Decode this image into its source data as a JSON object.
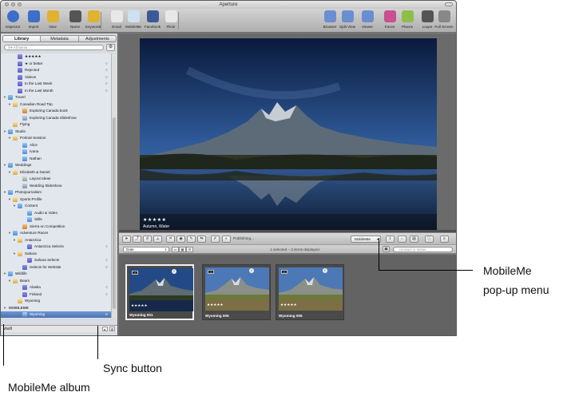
{
  "window": {
    "title": "Aperture"
  },
  "toolbar": {
    "left": [
      {
        "label": "Inspector",
        "icon": "inspector-info-icon"
      },
      {
        "label": "Import",
        "icon": "import-arrow-icon"
      },
      {
        "label": "New",
        "icon": "new-album-icon"
      },
      {
        "label": "Name",
        "icon": "name-badge-icon"
      },
      {
        "label": "Keywords",
        "icon": "keywords-tag-icon"
      },
      {
        "label": "Email",
        "icon": "email-icon"
      },
      {
        "label": "MobileMe",
        "icon": "mobileme-cloud-icon"
      },
      {
        "label": "Facebook",
        "icon": "facebook-icon"
      },
      {
        "label": "Flickr",
        "icon": "flickr-icon"
      }
    ],
    "right": [
      {
        "label": "Browser",
        "icon": "browser-grid-icon"
      },
      {
        "label": "Split View",
        "icon": "split-view-icon"
      },
      {
        "label": "Viewer",
        "icon": "viewer-icon"
      },
      {
        "label": "Faces",
        "icon": "faces-icon"
      },
      {
        "label": "Places",
        "icon": "places-icon"
      },
      {
        "label": "Loupe",
        "icon": "loupe-icon"
      },
      {
        "label": "Full Screen",
        "icon": "full-screen-icon"
      }
    ]
  },
  "sidebar": {
    "tabs": [
      {
        "label": "Library",
        "active": true
      },
      {
        "label": "Metadata",
        "active": false
      },
      {
        "label": "Adjustments",
        "active": false
      }
    ],
    "search_placeholder": "All Items",
    "items": [
      {
        "label": "★★★★★",
        "icon": "smart-album",
        "indent": 2
      },
      {
        "label": "★ or better",
        "icon": "smart-album",
        "indent": 2,
        "right": "⚲"
      },
      {
        "label": "Rejected",
        "icon": "smart-album",
        "indent": 2,
        "right": "⚲"
      },
      {
        "label": "Videos",
        "icon": "smart-album",
        "indent": 2,
        "right": "⚲"
      },
      {
        "label": "In the Last Week",
        "icon": "smart-album",
        "indent": 2,
        "right": "⚲"
      },
      {
        "label": "In the Last Month",
        "icon": "smart-album",
        "indent": 2,
        "right": "⚲"
      },
      {
        "label": "Travel",
        "icon": "folder",
        "indent": 0,
        "disclosure": "▼"
      },
      {
        "label": "Canadian Road Trip",
        "icon": "project",
        "indent": 1,
        "disclosure": "▼"
      },
      {
        "label": "Exploring Canada book",
        "icon": "book",
        "indent": 3
      },
      {
        "label": "Exploring Canada Slideshow",
        "icon": "slideshow",
        "indent": 3
      },
      {
        "label": "Flying",
        "icon": "project",
        "indent": 1
      },
      {
        "label": "Studio",
        "icon": "folder",
        "indent": 0,
        "disclosure": "▼"
      },
      {
        "label": "Portrait Session",
        "icon": "project",
        "indent": 1,
        "disclosure": "▼"
      },
      {
        "label": "Alice",
        "icon": "album",
        "indent": 3
      },
      {
        "label": "Ivana",
        "icon": "album",
        "indent": 3
      },
      {
        "label": "Nathan",
        "icon": "album",
        "indent": 3
      },
      {
        "label": "Weddings",
        "icon": "folder",
        "indent": 0,
        "disclosure": "▼"
      },
      {
        "label": "Elizabeth & Daniel",
        "icon": "project",
        "indent": 1,
        "disclosure": "▼"
      },
      {
        "label": "Layout Ideas",
        "icon": "light-table",
        "indent": 3
      },
      {
        "label": "Wedding Slideshow",
        "icon": "slideshow",
        "indent": 3
      },
      {
        "label": "Photojournalism",
        "icon": "folder",
        "indent": 0,
        "disclosure": "▼"
      },
      {
        "label": "Sports Profile",
        "icon": "project",
        "indent": 1,
        "disclosure": "▼"
      },
      {
        "label": "Content",
        "icon": "folder",
        "indent": 2,
        "disclosure": "▼"
      },
      {
        "label": "Audio & Video",
        "icon": "album",
        "indent": 4
      },
      {
        "label": "Stills",
        "icon": "album",
        "indent": 4
      },
      {
        "label": "Sierra on Competition",
        "icon": "book",
        "indent": 3
      },
      {
        "label": "Adventure Races",
        "icon": "folder",
        "indent": 1,
        "disclosure": "▼"
      },
      {
        "label": "Antarctica",
        "icon": "project",
        "indent": 2,
        "disclosure": "▼"
      },
      {
        "label": "Antarctica Selects",
        "icon": "smart-album",
        "indent": 4,
        "right": "⚲"
      },
      {
        "label": "Sahara",
        "icon": "project",
        "indent": 2,
        "disclosure": "▼"
      },
      {
        "label": "Sahara Selects",
        "icon": "smart-album",
        "indent": 4,
        "right": "⚲"
      },
      {
        "label": "Selects for Website",
        "icon": "smart-album",
        "indent": 3,
        "right": "⚲"
      },
      {
        "label": "Wildlife",
        "icon": "folder",
        "indent": 0,
        "disclosure": "▼"
      },
      {
        "label": "Bears",
        "icon": "project",
        "indent": 1,
        "disclosure": "▼"
      },
      {
        "label": "Alaska",
        "icon": "smart-album",
        "indent": 3,
        "right": "⚲"
      },
      {
        "label": "Finland",
        "icon": "smart-album",
        "indent": 3,
        "right": "⚲"
      },
      {
        "label": "Wyoming",
        "icon": "project",
        "indent": 2
      },
      {
        "label": "MOBILEME",
        "icon": "none",
        "indent": 0,
        "disclosure": "▼",
        "header": true
      },
      {
        "label": "Wyoming",
        "icon": "mobileme-album",
        "indent": 3,
        "selected": true
      }
    ],
    "vault_label": "Vault"
  },
  "viewer": {
    "stars": "★★★★★",
    "caption": "Autumn, Water"
  },
  "controls": {
    "publishing_label": "Publishing...",
    "share_menu_value": "MobileMe"
  },
  "browser_bar": {
    "sort_value": "Date",
    "status_text": "1 selected – 3 items displayed",
    "filter_placeholder": "Unrated or Better"
  },
  "thumbnails": [
    {
      "name": "Wyoming 001",
      "stars": "★★★★★",
      "selected": true
    },
    {
      "name": "Wyoming 005",
      "stars": "★★★★★",
      "selected": false
    },
    {
      "name": "Wyoming 006",
      "stars": "★★★★★",
      "selected": false
    }
  ],
  "callouts": {
    "popup_line1": "MobileMe",
    "popup_line2": "pop-up menu",
    "sync": "Sync button",
    "album": "MobileMe album"
  }
}
